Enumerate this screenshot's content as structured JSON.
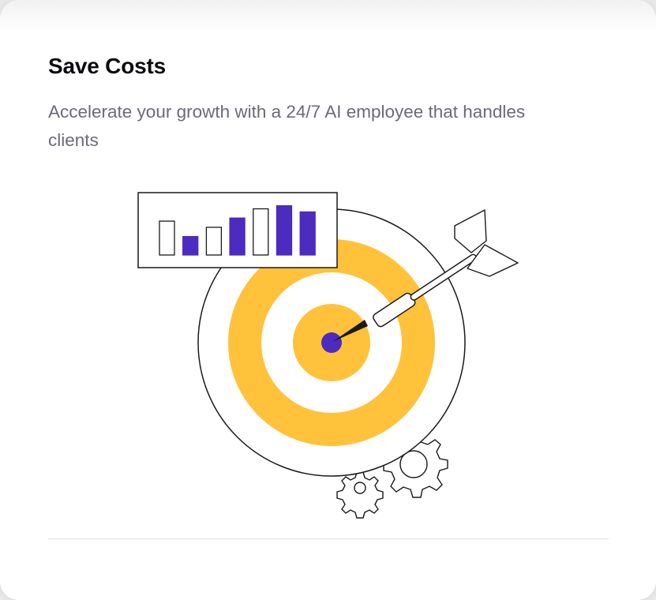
{
  "card": {
    "title": "Save Costs",
    "description": "Accelerate your growth with a 24/7 AI employee that handles clients"
  },
  "illustration": {
    "subject": "target-with-dart",
    "colors": {
      "ring": "#ffc23a",
      "bull": "#4b2bc0",
      "bar_fill": "#4b2bc0",
      "stroke": "#1a1a1a"
    },
    "bars": [
      {
        "level": 0.55,
        "filled": false
      },
      {
        "level": 0.3,
        "filled": true
      },
      {
        "level": 0.45,
        "filled": false
      },
      {
        "level": 0.6,
        "filled": true
      },
      {
        "level": 0.75,
        "filled": false
      },
      {
        "level": 0.8,
        "filled": true
      },
      {
        "level": 0.7,
        "filled": true
      }
    ]
  }
}
